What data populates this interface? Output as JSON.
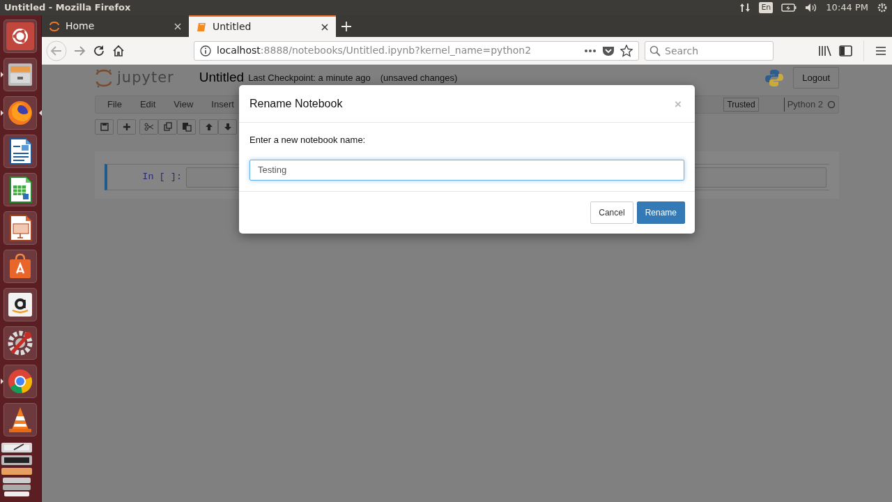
{
  "os_top_bar": {
    "title": "Untitled - Mozilla Firefox",
    "keyboard_layout": "En",
    "clock": "10:44 PM"
  },
  "launcher": [
    {
      "running": false,
      "focused": false
    },
    {
      "running": true,
      "focused": false
    },
    {
      "running": true,
      "focused": true
    },
    {
      "running": false,
      "focused": false
    },
    {
      "running": false,
      "focused": false
    },
    {
      "running": false,
      "focused": false
    },
    {
      "running": false,
      "focused": false
    },
    {
      "running": false,
      "focused": false
    },
    {
      "running": false,
      "focused": false
    },
    {
      "running": true,
      "focused": false
    },
    {
      "running": false,
      "focused": false
    }
  ],
  "browser": {
    "tabs": [
      {
        "label": "Home",
        "selected": false
      },
      {
        "label": "Untitled",
        "selected": true
      }
    ],
    "url": {
      "host": "localhost",
      "rest": ":8888/notebooks/Untitled.ipynb?kernel_name=python2"
    },
    "search": {
      "placeholder": "Search"
    }
  },
  "notebook": {
    "logo_text": "jupyter",
    "name": "Untitled",
    "checkpoint": "Last Checkpoint: a minute ago",
    "save_status": "(unsaved changes)",
    "logout": "Logout",
    "menu": [
      "File",
      "Edit",
      "View",
      "Insert"
    ],
    "toolbar": [
      {
        "kind": "save"
      },
      {
        "kind": "add"
      },
      {
        "kind": "cut"
      },
      {
        "kind": "copy"
      },
      {
        "kind": "paste"
      },
      {
        "kind": "up"
      },
      {
        "kind": "down"
      }
    ],
    "trusted": "Trusted",
    "kernel": "Python 2",
    "kernel_busy": false,
    "cell_prompt": "In [ ]:"
  },
  "dialog": {
    "title": "Rename Notebook",
    "close": "×",
    "label": "Enter a new notebook name:",
    "value": "Testing",
    "buttons": [
      {
        "label": "Cancel",
        "kind": "default"
      },
      {
        "label": "Rename",
        "kind": "primary"
      }
    ]
  }
}
